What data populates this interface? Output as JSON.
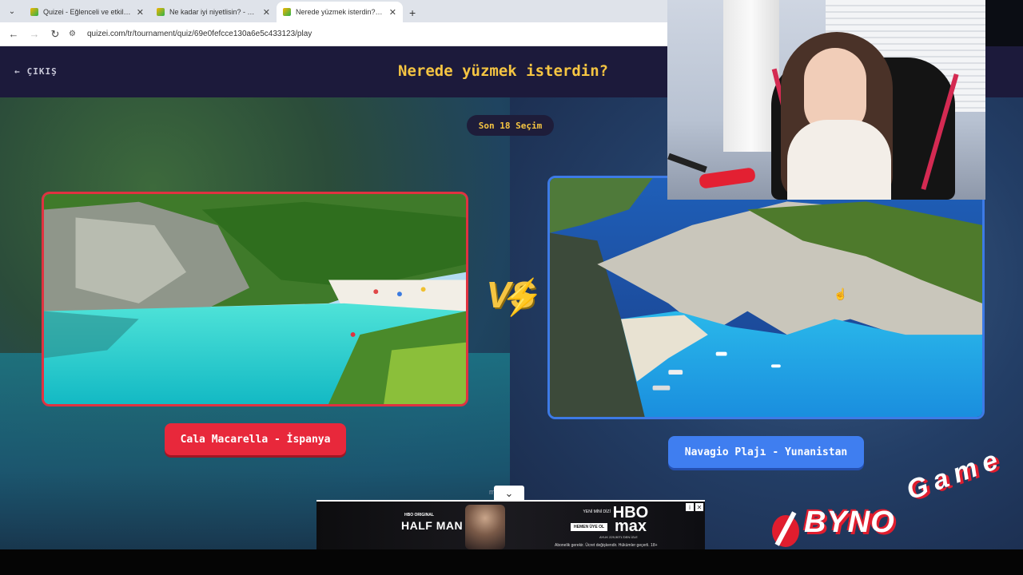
{
  "browser": {
    "tabs": [
      {
        "title": "Quizei - Eğlenceli ve etkileşimli",
        "active": false
      },
      {
        "title": "Ne kadar iyi niyetlisin? - Tier Li",
        "active": false
      },
      {
        "title": "Nerede yüzmek isterdin? - Tier",
        "active": true
      }
    ],
    "url": "quizei.com/tr/tournament/quiz/69e0fefcce130a6e5c433123/play"
  },
  "quiz": {
    "exit_label": "ÇIKIŞ",
    "title": "Nerede yüzmek isterdin?",
    "counter": "Son 18 Seçim",
    "vs_label": "VS",
    "left_choice": {
      "label": "Cala Macarella - İspanya",
      "color": "#e8283b"
    },
    "right_choice": {
      "label": "Navagio Plajı - Yunanistan",
      "color": "#3f7ef0"
    },
    "scroll_hint": "m          h"
  },
  "ad": {
    "brand_small": "HBO ORIGINAL",
    "title": "HALF MAN",
    "new_series": "YENİ MİNİ DİZİ",
    "cta": "HEMEN ÜYE OL",
    "hbo": "HBO",
    "max": "max",
    "price": "AYLIK 229,90TL'DEN İZLE",
    "legal": "Abonelik gerekir. Ücret değişkendir. Hükümler geçerli. 18+"
  },
  "overlay": {
    "logo_byno": "BYNO",
    "logo_game": "Game"
  },
  "colors": {
    "accent_yellow": "#f5c542",
    "page_bg": "#1c1a3b",
    "left_border": "#e03240",
    "right_border": "#3d7ae6"
  }
}
